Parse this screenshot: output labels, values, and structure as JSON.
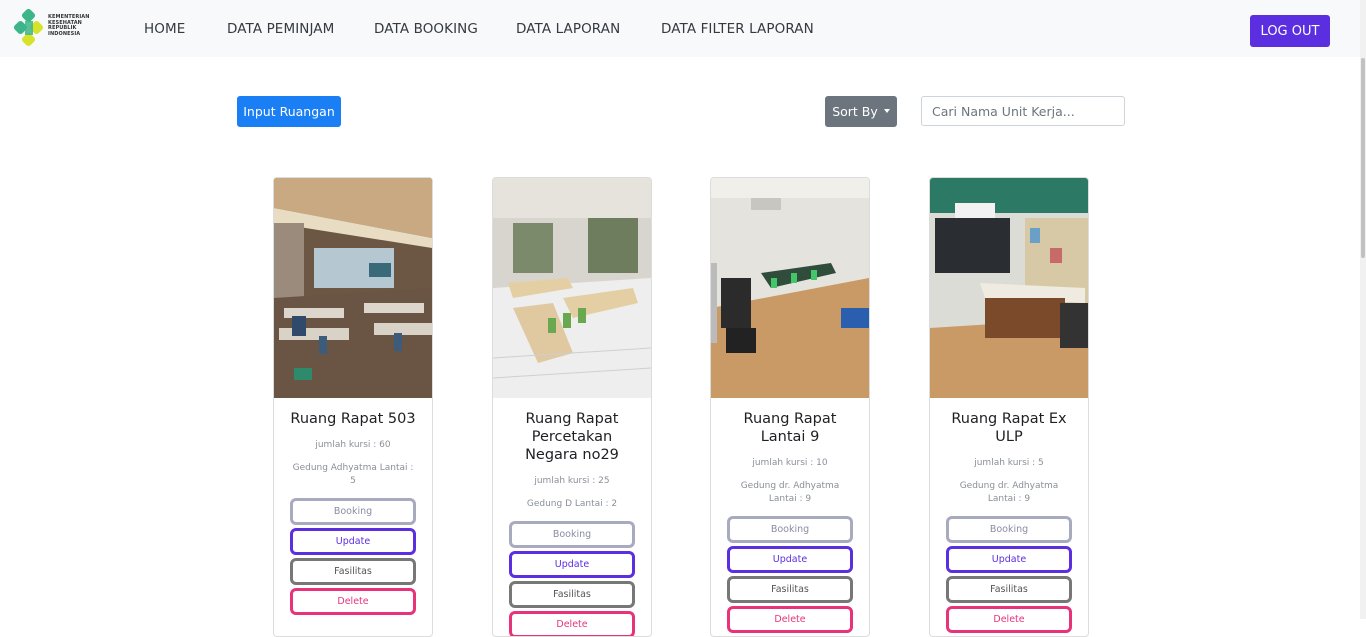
{
  "logo": {
    "lines": [
      "KEMENTERIAN",
      "KESEHATAN",
      "REPUBLIK",
      "INDONESIA"
    ]
  },
  "nav": {
    "items": [
      "HOME",
      "DATA PEMINJAM",
      "DATA BOOKING",
      "DATA LAPORAN",
      "DATA FILTER LAPORAN"
    ],
    "logout": "LOG OUT"
  },
  "toolbar": {
    "input_label": "Input Ruangan",
    "sort_label": "Sort By",
    "search_placeholder": "Cari Nama Unit Kerja..."
  },
  "cards": [
    {
      "title": "Ruang Rapat 503",
      "seats": "jumlah kursi : 60",
      "building": "Gedung Adhyatma Lantai : 5",
      "buttons": [
        "Booking",
        "Update",
        "Fasilitas",
        "Delete"
      ]
    },
    {
      "title": "Ruang Rapat Percetakan Negara no29",
      "seats": "jumlah kursi : 25",
      "building": "Gedung D Lantai : 2",
      "buttons": [
        "Booking",
        "Update",
        "Fasilitas",
        "Delete"
      ]
    },
    {
      "title": "Ruang Rapat Lantai 9",
      "seats": "jumlah kursi : 10",
      "building": "Gedung dr. Adhyatma Lantai : 9",
      "buttons": [
        "Booking",
        "Update",
        "Fasilitas",
        "Delete"
      ]
    },
    {
      "title": "Ruang Rapat Ex ULP",
      "seats": "jumlah kursi : 5",
      "building": "Gedung dr. Adhyatma Lantai : 9",
      "buttons": [
        "Booking",
        "Update",
        "Fasilitas",
        "Delete"
      ]
    }
  ],
  "colors": {
    "primary": "#1a7ff5",
    "accent": "#5b2ee0",
    "danger": "#e8337a",
    "secondary": "#6c757d",
    "logo_green": "#3db58a",
    "logo_yellow": "#d7e32b"
  }
}
